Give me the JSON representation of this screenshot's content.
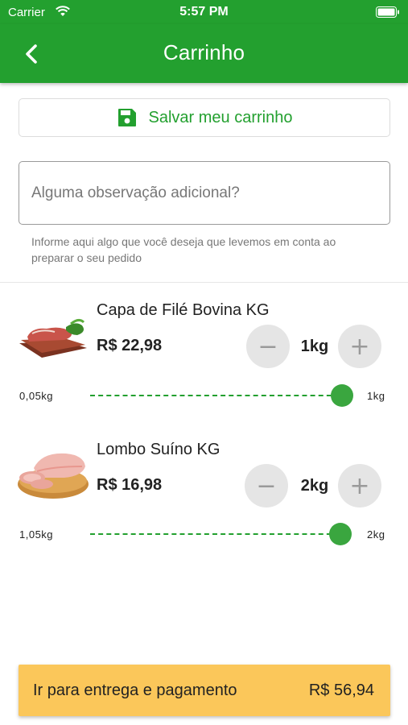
{
  "status_bar": {
    "carrier": "Carrier",
    "time": "5:57 PM"
  },
  "header": {
    "title": "Carrinho"
  },
  "colors": {
    "brand_green": "#23a02f",
    "checkout_yellow": "#fbc75a",
    "stepper_bg": "#e5e5e5"
  },
  "save_cart": {
    "label": "Salvar meu carrinho",
    "icon": "floppy-disk-icon"
  },
  "observation": {
    "placeholder": "Alguma observação adicional?",
    "value": "",
    "help": "Informe aqui algo que você deseja que levemos em conta ao preparar o seu pedido"
  },
  "cart": {
    "items": [
      {
        "name": "Capa de Filé Bovina KG",
        "price": "R$ 22,98",
        "quantity": "1kg",
        "slider_min": "0,05kg",
        "slider_max": "1kg",
        "slider_fraction": 1.0
      },
      {
        "name": "Lombo Suíno KG",
        "price": "R$ 16,98",
        "quantity": "2kg",
        "slider_min": "1,05kg",
        "slider_max": "2kg",
        "slider_fraction": 1.0
      }
    ]
  },
  "checkout": {
    "label": "Ir para entrega e pagamento",
    "total": "R$ 56,94"
  }
}
